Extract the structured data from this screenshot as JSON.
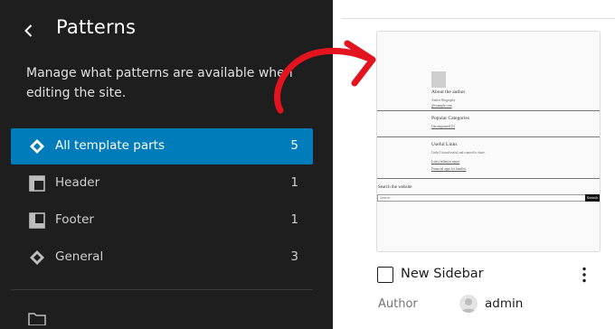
{
  "sidebar": {
    "title": "Patterns",
    "description": "Manage what patterns are available when editing the site.",
    "items": [
      {
        "label": "All template parts",
        "count": "5",
        "icon": "diamond-icon",
        "active": true
      },
      {
        "label": "Header",
        "count": "1",
        "icon": "header-layout-icon"
      },
      {
        "label": "Footer",
        "count": "1",
        "icon": "footer-layout-icon"
      },
      {
        "label": "General",
        "count": "3",
        "icon": "diamond-icon"
      }
    ]
  },
  "preview": {
    "about_heading": "About the author",
    "about_text": "Author Biography",
    "about_link": "@example.com",
    "popular_heading": "Popular Categories",
    "popular_item": "Uncategorized (1)",
    "useful_heading": "Useful Links",
    "useful_text": "Links I found useful and wanted to share.",
    "useful_link1": "Latest inflation report",
    "useful_link2": "Financial apps for families",
    "search_label": "Search the website",
    "search_placeholder": "Search...",
    "search_button": "Search"
  },
  "pattern": {
    "title": "New Sidebar",
    "author_label": "Author",
    "author_name": "admin"
  },
  "colors": {
    "accent": "#007cba",
    "sidebar_bg": "#1e1e1e",
    "annotation_arrow": "#e3141f"
  }
}
